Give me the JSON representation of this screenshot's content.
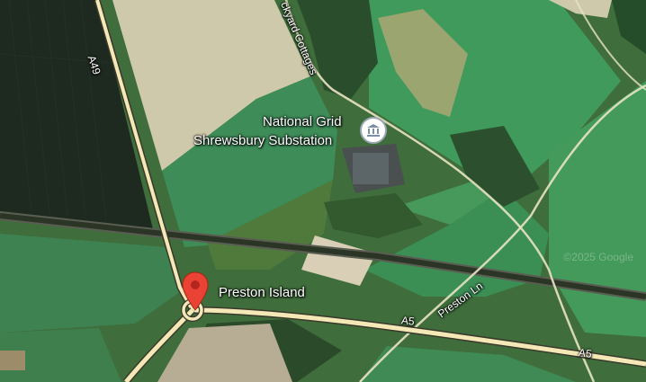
{
  "map": {
    "view": "satellite",
    "pin_color": "#ea4335"
  },
  "labels": {
    "poi_name_line1": "National Grid",
    "poi_name_line2": "Shrewsbury Substation",
    "poi_icon": "building-icon",
    "pin_label": "Preston Island",
    "road_a49": "A49",
    "road_cottages": "ckyard Cottages",
    "road_a5_1": "A5",
    "road_a5_2": "A5",
    "road_preston_ln": "Preston Ln",
    "copyright": "©2025 Google"
  }
}
